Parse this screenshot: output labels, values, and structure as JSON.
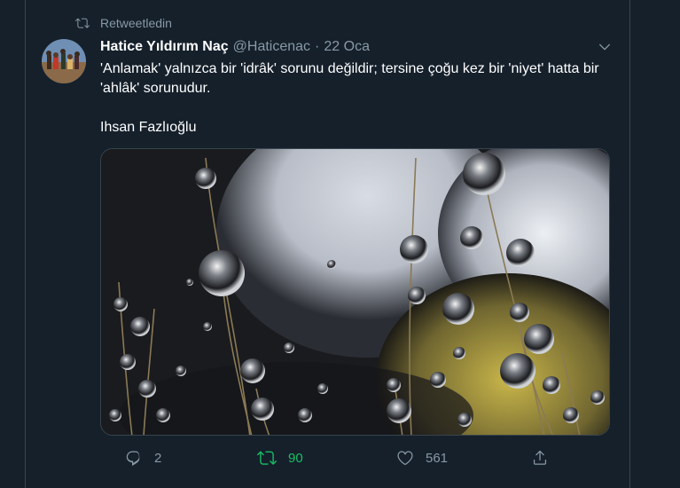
{
  "retweet": {
    "label": "Retweetledin",
    "icon": "retweet-icon"
  },
  "tweet": {
    "name": "Hatice Yıldırım Naç",
    "handle": "@Haticenac",
    "separator": "·",
    "date": "22 Oca",
    "text": "'Anlamak' yalnızca bir 'idrâk' sorunu değildir; tersine çoğu kez bir 'niyet' hatta bir 'ahlâk' sorunudur.\n\nIhsan Fazlıoğlu"
  },
  "actions": {
    "reply_count": "2",
    "retweet_count": "90",
    "like_count": "561"
  },
  "colors": {
    "background": "#15202b",
    "border": "#38444d",
    "muted": "#8899a6",
    "retweet_active": "#17bf63"
  }
}
